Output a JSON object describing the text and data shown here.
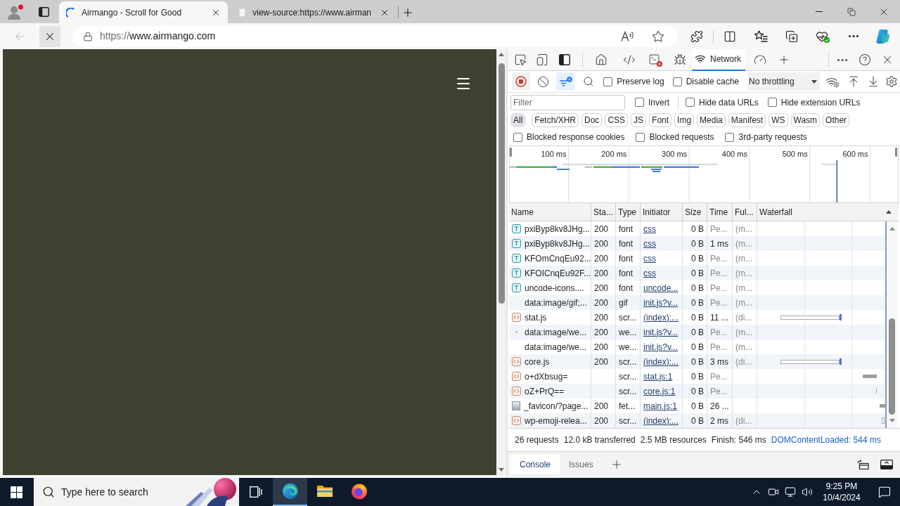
{
  "browser": {
    "tabs": [
      {
        "title": "Airmango - Scroll for Good",
        "selected": true,
        "loading": true
      },
      {
        "title": "view-source:https://www.airman",
        "selected": false,
        "loading": false
      }
    ],
    "back_disabled": true,
    "address": {
      "scheme": "https://",
      "host": "www.airmango.com"
    }
  },
  "devtools": {
    "panel_tabs": [
      {
        "label": "Network",
        "selected": true
      }
    ],
    "record_options": [
      {
        "label": "Preserve log",
        "checked": false
      },
      {
        "label": "Disable cache",
        "checked": false
      }
    ],
    "throttling": "No throttling",
    "filter": {
      "placeholder": "Filter"
    },
    "filter_options": [
      {
        "label": "Invert",
        "checked": false
      },
      {
        "label": "Hide data URLs",
        "checked": false
      },
      {
        "label": "Hide extension URLs",
        "checked": false
      }
    ],
    "type_filters": [
      {
        "label": "All",
        "selected": true
      },
      {
        "label": "Fetch/XHR",
        "selected": false
      },
      {
        "label": "Doc",
        "selected": false
      },
      {
        "label": "CSS",
        "selected": false
      },
      {
        "label": "JS",
        "selected": false
      },
      {
        "label": "Font",
        "selected": false
      },
      {
        "label": "Img",
        "selected": false
      },
      {
        "label": "Media",
        "selected": false
      },
      {
        "label": "Manifest",
        "selected": false
      },
      {
        "label": "WS",
        "selected": false
      },
      {
        "label": "Wasm",
        "selected": false
      },
      {
        "label": "Other",
        "selected": false
      }
    ],
    "blocked_options": [
      {
        "label": "Blocked response cookies",
        "checked": false
      },
      {
        "label": "Blocked requests",
        "checked": false
      },
      {
        "label": "3rd-party requests",
        "checked": false
      }
    ],
    "overview": {
      "ticks": [
        "100 ms",
        "200 ms",
        "300 ms",
        "400 ms",
        "500 ms",
        "600 ms"
      ]
    },
    "table": {
      "columns": [
        "Name",
        "Sta...",
        "Type",
        "Initiator",
        "Size",
        "Time",
        "Ful...",
        "Waterfall"
      ],
      "rows": [
        {
          "kind": "font",
          "name": "pxiByp8kv8JHg...",
          "status": "200",
          "type": "font",
          "initiator": "css",
          "size": "0 B",
          "time": "Pe...",
          "time_pending": true,
          "fulfilled": "(m..."
        },
        {
          "kind": "font",
          "name": "pxiByp8kv8JHg...",
          "status": "200",
          "type": "font",
          "initiator": "css",
          "size": "0 B",
          "time": "1 ms",
          "time_pending": false,
          "fulfilled": "(m..."
        },
        {
          "kind": "font",
          "name": "KFOmCnqEu92...",
          "status": "200",
          "type": "font",
          "initiator": "css",
          "size": "0 B",
          "time": "Pe...",
          "time_pending": true,
          "fulfilled": "(m..."
        },
        {
          "kind": "font",
          "name": "KFOICnqEu92F...",
          "status": "200",
          "type": "font",
          "initiator": "css",
          "size": "0 B",
          "time": "Pe...",
          "time_pending": true,
          "fulfilled": "(m..."
        },
        {
          "kind": "font",
          "name": "uncode-icons....",
          "status": "200",
          "type": "font",
          "initiator": "uncode...",
          "size": "0 B",
          "time": "Pe...",
          "time_pending": true,
          "fulfilled": "(m..."
        },
        {
          "kind": "data",
          "name": "data:image/gif;...",
          "status": "200",
          "type": "gif",
          "initiator": "init.js?v...",
          "size": "0 B",
          "time": "Pe...",
          "time_pending": true,
          "fulfilled": "(m..."
        },
        {
          "kind": "script",
          "name": "stat.js",
          "status": "200",
          "type": "scr...",
          "initiator": "(index):...",
          "size": "0 B",
          "time": "11 ...",
          "time_pending": false,
          "fulfilled": "(di...",
          "waterfall": {
            "kind": "wait"
          }
        },
        {
          "kind": "pixel",
          "name": "data:image/we...",
          "status": "200",
          "type": "we...",
          "initiator": "init.js?v...",
          "size": "0 B",
          "time": "Pe...",
          "time_pending": true,
          "fulfilled": "(m..."
        },
        {
          "kind": "data",
          "name": "data:image/we...",
          "status": "200",
          "type": "we...",
          "initiator": "init.js?v...",
          "size": "0 B",
          "time": "Pe...",
          "time_pending": true,
          "fulfilled": "(m..."
        },
        {
          "kind": "script",
          "name": "core.js",
          "status": "200",
          "type": "scr...",
          "initiator": "(index):...",
          "size": "0 B",
          "time": "3 ms",
          "time_pending": false,
          "fulfilled": "(di...",
          "waterfall": {
            "kind": "wait"
          }
        },
        {
          "kind": "script",
          "name": "o+dXbsug=",
          "type": "scr...",
          "initiator": "stat.js:1",
          "size": "0 B",
          "time": "Pe...",
          "time_pending": true,
          "waterfall": {
            "kind": "queued"
          }
        },
        {
          "kind": "script",
          "name": "oZ+PrQ==",
          "type": "scr...",
          "initiator": "core.js:1",
          "size": "0 B",
          "time": "Pe...",
          "time_pending": true,
          "waterfall": {
            "kind": "stub"
          }
        },
        {
          "kind": "fetch",
          "name": "_favicon/?page...",
          "status": "200",
          "type": "fet...",
          "initiator": "main.js:1",
          "size": "0 B",
          "time": "26 ...",
          "time_pending": false,
          "waterfall": {
            "kind": "late"
          }
        },
        {
          "kind": "script",
          "name": "wp-emoji-relea...",
          "status": "200",
          "type": "scr...",
          "initiator": "(index):...",
          "size": "0 B",
          "time": "2 ms",
          "time_pending": false,
          "fulfilled": "(di...",
          "waterfall": {
            "kind": "edge"
          }
        }
      ]
    },
    "summary": [
      "26 requests",
      "12.0 kB transferred",
      "2.5 MB resources",
      "Finish: 546 ms"
    ],
    "dom_content_loaded": "DOMContentLoaded: 544 ms",
    "drawer_tabs": [
      {
        "label": "Console",
        "selected": true
      },
      {
        "label": "Issues",
        "selected": false
      }
    ]
  },
  "taskbar": {
    "search": {
      "placeholder": "Type here to search"
    },
    "apps": [
      {
        "kind": "edge",
        "selected": true
      },
      {
        "kind": "explorer",
        "selected": false
      },
      {
        "kind": "firefox",
        "selected": false
      }
    ],
    "time": "9:25 PM",
    "date": "10/4/2024"
  }
}
